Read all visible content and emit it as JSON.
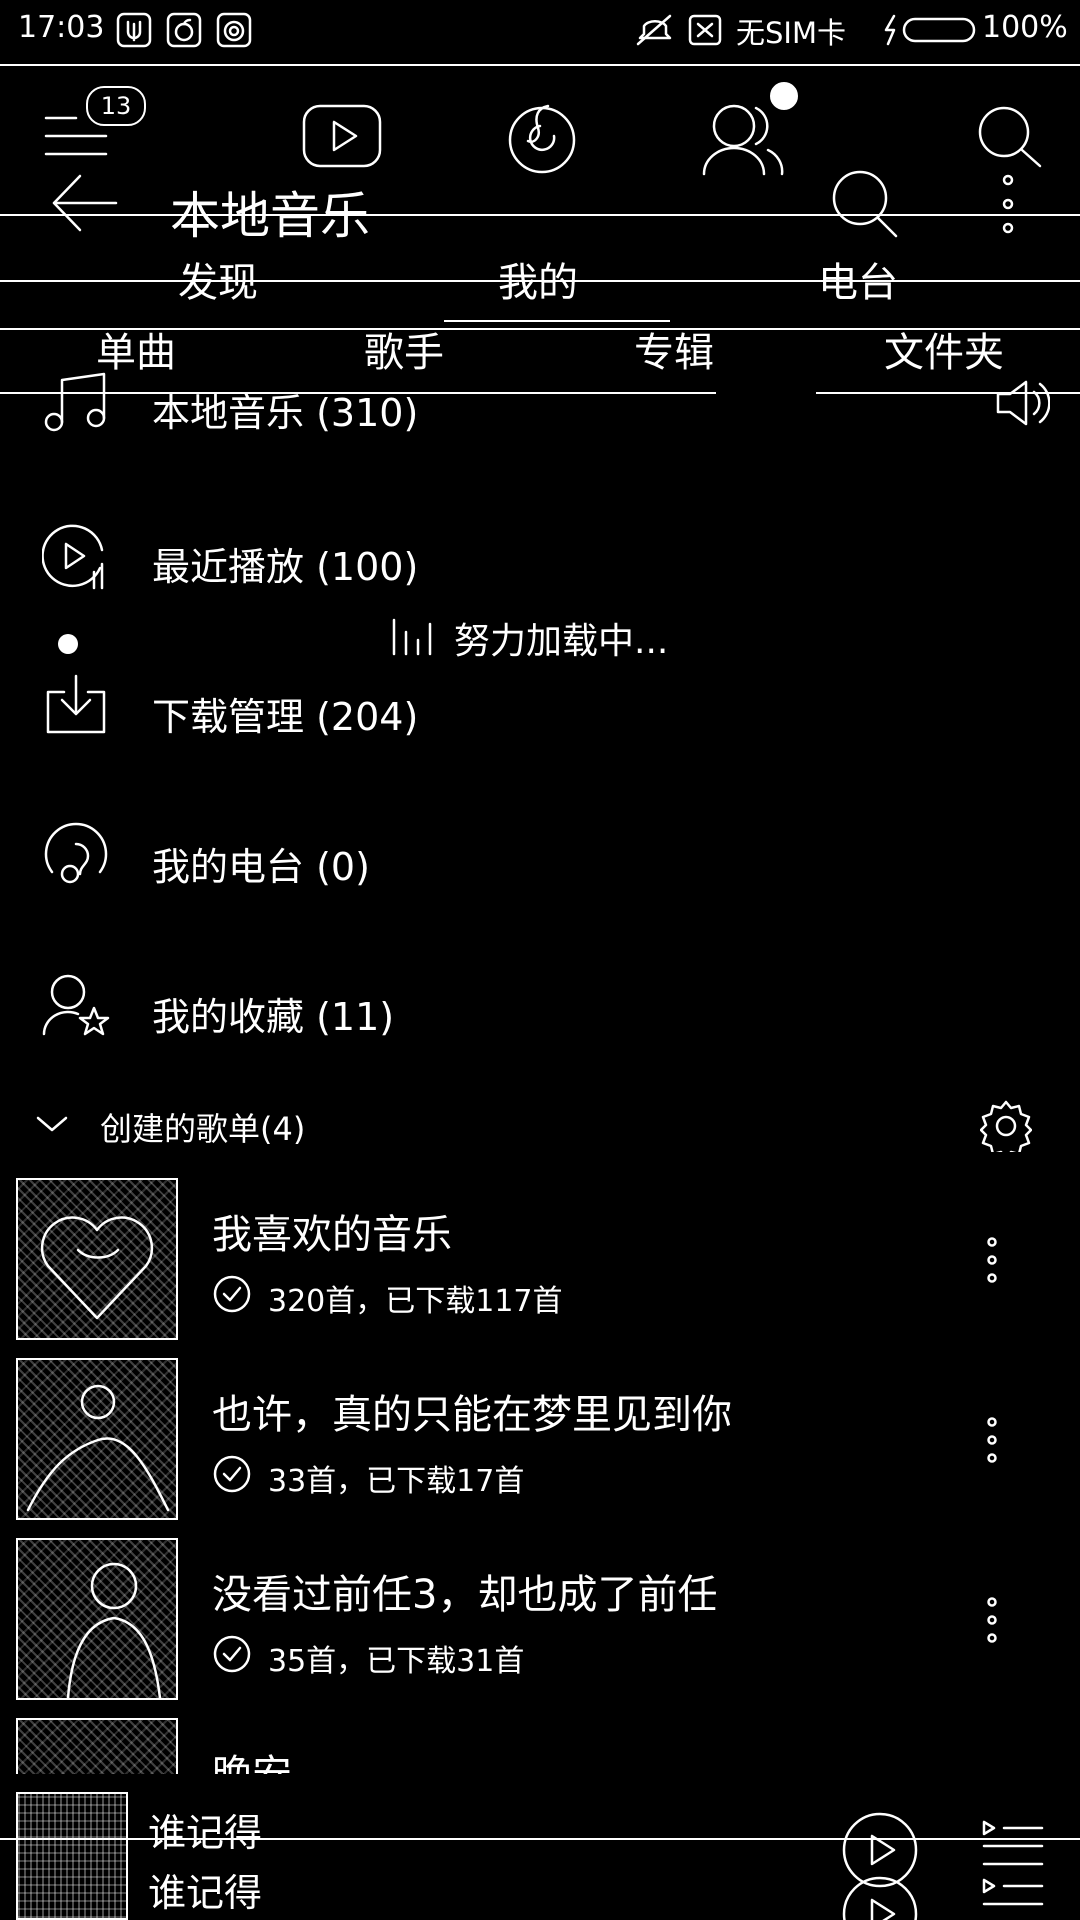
{
  "status_bar": {
    "time": "17:03",
    "sim": "无SIM卡",
    "battery": "100%"
  },
  "top_nav": {
    "badge_count": "13",
    "icons": [
      "menu-icon",
      "video-icon",
      "music-logo-icon",
      "friends-icon",
      "search-icon"
    ]
  },
  "header": {
    "title": "本地音乐"
  },
  "main_tabs": [
    {
      "label": "发现"
    },
    {
      "label": "我的"
    },
    {
      "label": "电台"
    }
  ],
  "local_tabs": [
    {
      "label": "单曲"
    },
    {
      "label": "歌手"
    },
    {
      "label": "专辑"
    },
    {
      "label": "文件夹"
    }
  ],
  "menu": [
    {
      "label": "本地音乐",
      "count": "(310)",
      "icon": "music-note-icon"
    },
    {
      "label": "最近播放",
      "count": "(100)",
      "icon": "recent-play-icon"
    },
    {
      "label": "下载管理",
      "count": "(204)",
      "icon": "download-icon"
    },
    {
      "label": "我的电台",
      "count": "(0)",
      "icon": "radio-icon"
    },
    {
      "label": "我的收藏",
      "count": "(11)",
      "icon": "favorite-user-icon"
    }
  ],
  "loading": {
    "text": "努力加载中..."
  },
  "playlists_section": {
    "title": "创建的歌单(4)"
  },
  "playlists": [
    {
      "name": "我喜欢的音乐",
      "meta": "320首，已下载117首"
    },
    {
      "name": "也许，真的只能在梦里见到你",
      "meta": "33首，已下载17首"
    },
    {
      "name": "没看过前任3，却也成了前任",
      "meta": "35首，已下载31首"
    },
    {
      "name": "晚安",
      "meta": ""
    }
  ],
  "player": {
    "song_line1": "谁记得",
    "song_line2": "谁记得"
  }
}
